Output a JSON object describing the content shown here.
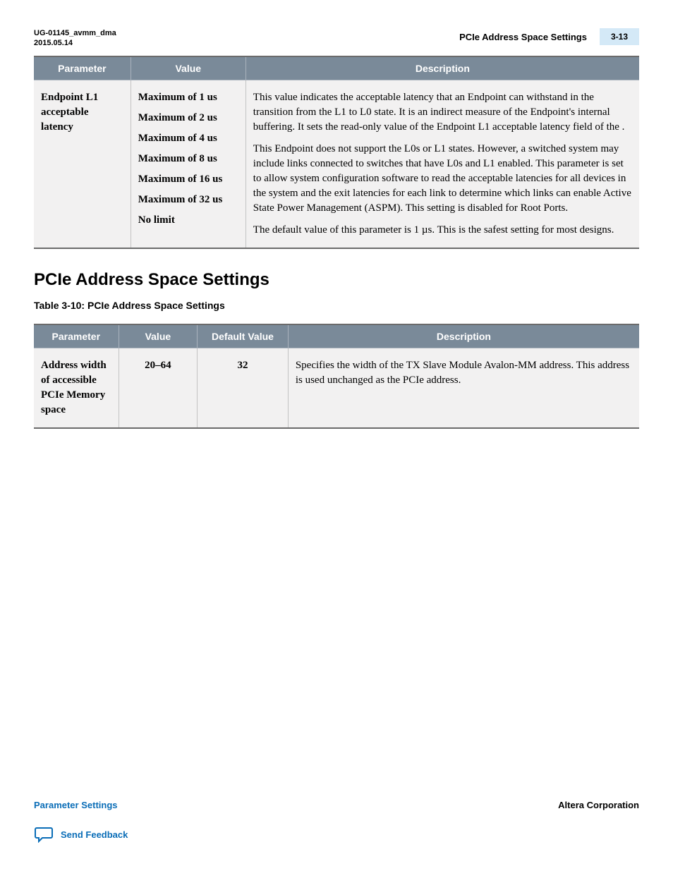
{
  "header": {
    "doc_id": "UG-01145_avmm_dma",
    "date": "2015.05.14",
    "title": "PCIe Address Space Settings",
    "page_num": "3-13"
  },
  "table1": {
    "headers": [
      "Parameter",
      "Value",
      "Description"
    ],
    "row": {
      "parameter": "Endpoint L1 acceptable latency",
      "values": [
        "Maximum of 1 us",
        "Maximum of 2 us",
        "Maximum of 4 us",
        "Maximum of 8 us",
        "Maximum of 16 us",
        "Maximum of 32 us",
        "No limit"
      ],
      "description": [
        "This value indicates the acceptable latency that an Endpoint can withstand in the transition from the L1 to L0 state. It is an indirect measure of the Endpoint's internal buffering. It sets the read-only value of the Endpoint L1 acceptable latency field of the                                                                       .",
        "This Endpoint does not support the L0s or L1 states. However, a switched system may include links connected to switches that have L0s and L1 enabled. This parameter is set to allow system configuration software to read the acceptable latencies for all devices in the system and the exit latencies for each link to determine which links can enable Active State Power Management (ASPM). This setting is disabled for Root Ports.",
        "The default value of this parameter is 1 µs. This is the safest setting for most designs."
      ]
    }
  },
  "section": {
    "heading": "PCIe Address Space Settings",
    "table_caption": "Table 3-10: PCIe Address Space Settings"
  },
  "table2": {
    "headers": [
      "Parameter",
      "Value",
      "Default Value",
      "Description"
    ],
    "row": {
      "parameter": "Address width of accessible PCIe Memory space",
      "value": "20–64",
      "default": "32",
      "description": "Specifies the width of the TX Slave Module Avalon-MM address. This address is used unchanged as the PCIe address."
    }
  },
  "footer": {
    "left_link": "Parameter Settings",
    "right_text": "Altera Corporation",
    "feedback": "Send Feedback"
  }
}
